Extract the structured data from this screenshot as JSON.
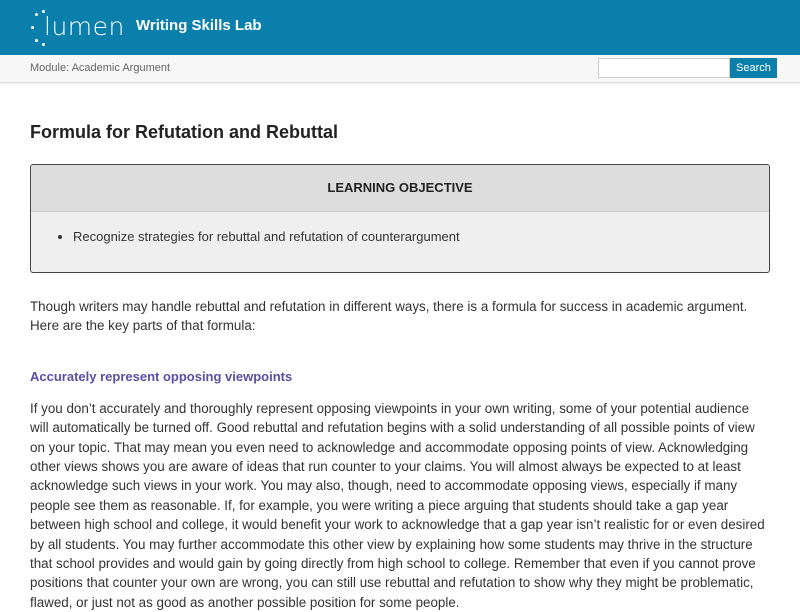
{
  "header": {
    "logo_text": "lumen",
    "site_title": "Writing Skills Lab"
  },
  "subbar": {
    "module": "Module: Academic Argument",
    "search_placeholder": "",
    "search_label": "Search"
  },
  "page": {
    "title": "Formula for Refutation and Rebuttal",
    "learning_objective": {
      "heading": "LEARNING OBJECTIVE",
      "items": [
        "Recognize strategies for rebuttal and refutation of counterargument"
      ]
    },
    "intro": "Though writers may handle rebuttal and refutation in different ways, there is a formula for success in academic argument. Here are the key parts of that formula:",
    "section_heading": "Accurately represent opposing viewpoints",
    "section_body": "If you don’t accurately and thoroughly represent opposing viewpoints in your own writing, some of your potential audience will automatically be turned off. Good rebuttal and refutation begins with a solid understanding of all possible points of view on your topic. That may mean you even need to acknowledge and accommodate opposing points of view. Acknowledging other views shows you are aware of ideas that run counter to your claims. You will almost always be expected to at least acknowledge such views in your work. You may also, though, need to accommodate opposing views, especially if many people see them as reasonable. If, for example, you were writing a piece arguing that students should take a gap year between high school and college, it would benefit your work to acknowledge that a gap year isn’t realistic for or even desired by all students. You may further accommodate this other view by explaining how some students may thrive in the structure that school provides and would gain by going directly from high school to college. Remember that even if you cannot prove positions that counter your own are wrong, you can still use rebuttal and refutation to show why they might be problematic, flawed, or just not as good as another possible position for some people."
  }
}
